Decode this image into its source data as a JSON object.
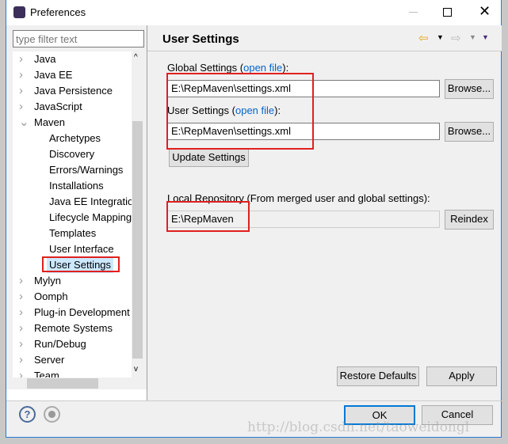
{
  "window": {
    "title": "Preferences"
  },
  "filter": {
    "placeholder": "type filter text"
  },
  "tree": [
    {
      "label": "Java",
      "level": 0,
      "expand": ">"
    },
    {
      "label": "Java EE",
      "level": 0,
      "expand": ">"
    },
    {
      "label": "Java Persistence",
      "level": 0,
      "expand": ">"
    },
    {
      "label": "JavaScript",
      "level": 0,
      "expand": ">"
    },
    {
      "label": "Maven",
      "level": 0,
      "expand": "v"
    },
    {
      "label": "Archetypes",
      "level": 1
    },
    {
      "label": "Discovery",
      "level": 1
    },
    {
      "label": "Errors/Warnings",
      "level": 1
    },
    {
      "label": "Installations",
      "level": 1
    },
    {
      "label": "Java EE Integration",
      "level": 1
    },
    {
      "label": "Lifecycle Mapping",
      "level": 1
    },
    {
      "label": "Templates",
      "level": 1
    },
    {
      "label": "User Interface",
      "level": 1
    },
    {
      "label": "User Settings",
      "level": 1,
      "selected": true
    },
    {
      "label": "Mylyn",
      "level": 0,
      "expand": ">"
    },
    {
      "label": "Oomph",
      "level": 0,
      "expand": ">"
    },
    {
      "label": "Plug-in Development",
      "level": 0,
      "expand": ">"
    },
    {
      "label": "Remote Systems",
      "level": 0,
      "expand": ">"
    },
    {
      "label": "Run/Debug",
      "level": 0,
      "expand": ">"
    },
    {
      "label": "Server",
      "level": 0,
      "expand": ">"
    },
    {
      "label": "Team",
      "level": 0,
      "expand": ">"
    }
  ],
  "page": {
    "title": "User Settings",
    "global_label": "Global Settings (",
    "global_link": "open file",
    "global_end": "):",
    "global_value": "E:\\RepMaven\\settings.xml",
    "user_label": "User Settings (",
    "user_link": "open file",
    "user_end": "):",
    "user_value": "E:\\RepMaven\\settings.xml",
    "browse": "Browse...",
    "update": "Update Settings",
    "local_label": "Local Repository (From merged user and global settings):",
    "local_value": "E:\\RepMaven",
    "reindex": "Reindex",
    "restore": "Restore Defaults",
    "apply": "Apply"
  },
  "footer": {
    "ok": "OK",
    "cancel": "Cancel"
  },
  "watermark": "http://blog.csdn.net/taoweidongl",
  "colors": {
    "highlight": "#e02020",
    "link": "#0066cc",
    "accent": "#2b7ad6"
  }
}
